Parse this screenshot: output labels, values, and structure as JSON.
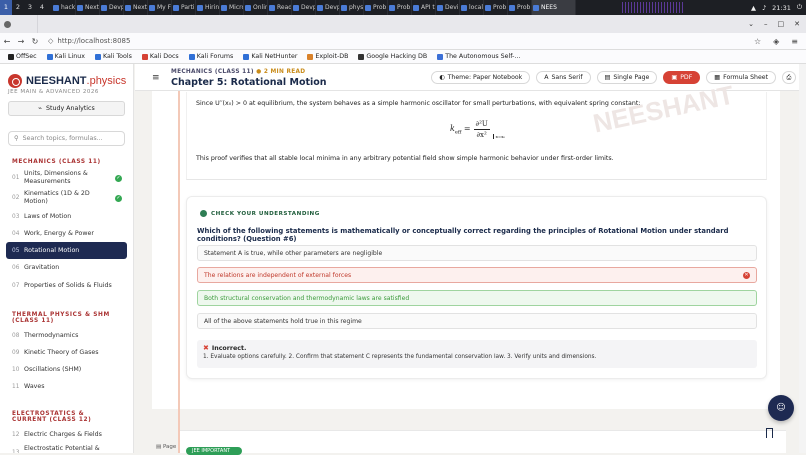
{
  "os_bar": {
    "workspaces": [
      "1",
      "2",
      "3",
      "4"
    ],
    "active_workspace": "1",
    "tabs": [
      "hack",
      "Next",
      "Devp",
      "Next",
      "My F",
      "Parti",
      "Hirin",
      "Micro",
      "Onlin",
      "Read",
      "Devp",
      "Devp",
      "phys",
      "Prob",
      "Prob",
      "API t",
      "Devi",
      "local",
      "Prob",
      "Prob",
      "NEES"
    ],
    "clock": "21:31"
  },
  "browser": {
    "url": "http://localhost:8085",
    "bookmarks": [
      "OffSec",
      "Kali Linux",
      "Kali Tools",
      "Kali Docs",
      "Kali Forums",
      "Kali NetHunter",
      "Exploit-DB",
      "Google Hacking DB",
      "The Autonomous Self-..."
    ]
  },
  "sidebar": {
    "brand_main": "NEESHANT",
    "brand_accent": ".physics",
    "brand_sub": "JEE MAIN & ADVANCED 2026",
    "analytics_label": "Study Analytics",
    "search_placeholder": "Search topics, formulas...",
    "sections": [
      {
        "title": "MECHANICS (CLASS 11)",
        "items": [
          {
            "num": "01",
            "label": "Units, Dimensions & Measurements",
            "done": true
          },
          {
            "num": "02",
            "label": "Kinematics (1D & 2D Motion)",
            "done": true
          },
          {
            "num": "03",
            "label": "Laws of Motion"
          },
          {
            "num": "04",
            "label": "Work, Energy & Power"
          },
          {
            "num": "05",
            "label": "Rotational Motion",
            "active": true
          },
          {
            "num": "06",
            "label": "Gravitation"
          },
          {
            "num": "07",
            "label": "Properties of Solids & Fluids"
          }
        ]
      },
      {
        "title": "THERMAL PHYSICS & SHM (CLASS 11)",
        "items": [
          {
            "num": "08",
            "label": "Thermodynamics"
          },
          {
            "num": "09",
            "label": "Kinetic Theory of Gases"
          },
          {
            "num": "10",
            "label": "Oscillations (SHM)"
          },
          {
            "num": "11",
            "label": "Waves"
          }
        ]
      },
      {
        "title": "ELECTROSTATICS & CURRENT (CLASS 12)",
        "items": [
          {
            "num": "12",
            "label": "Electric Charges & Fields"
          },
          {
            "num": "13",
            "label": "Electrostatic Potential & Capacitance"
          }
        ]
      }
    ]
  },
  "topbar": {
    "breadcrumb": "MECHANICS (CLASS 11)",
    "read_time": "2 MIN READ",
    "chapter_title": "Chapter 5: Rotational Motion",
    "theme_label": "Theme: Paper Notebook",
    "font_label": "Sans Serif",
    "view_label": "Single Page",
    "pdf_label": "PDF",
    "formula_label": "Formula Sheet"
  },
  "proof": {
    "watermark": "NEESHANT",
    "para1": "Since U′′(x₀) > 0 at equilibrium, the system behaves as a simple harmonic oscillator for small perturbations, with equivalent spring constant:",
    "formula_lhs": "k",
    "formula_sub": "eff",
    "formula_num": "∂²U",
    "formula_den": "∂x²",
    "formula_eval": "x=x₀",
    "para2": "This proof verifies that all stable local minima in any arbitrary potential field show simple harmonic behavior under first-order limits."
  },
  "quiz": {
    "header": "CHECK YOUR UNDERSTANDING",
    "question": "Which of the following statements is mathematically or conceptually correct regarding the principles of Rotational Motion under standard conditions? (Question #6)",
    "options": [
      {
        "text": "Statement A is true, while other parameters are negligible",
        "state": "neutral"
      },
      {
        "text": "The relations are independent of external forces",
        "state": "wrong"
      },
      {
        "text": "Both structural conservation and thermodynamic laws are satisfied",
        "state": "correct"
      },
      {
        "text": "All of the above statements hold true in this regime",
        "state": "neutral"
      }
    ],
    "feedback_title": "Incorrect.",
    "feedback_text": "1. Evaluate options carefully. 2. Confirm that statement C represents the fundamental conservation law. 3. Verify units and dimensions."
  },
  "footer": {
    "page_label": "Page",
    "badge": "JEE IMPORTANT"
  },
  "colors": {
    "accent_red": "#d64235",
    "navy": "#1e2a52",
    "green": "#2e7d54"
  }
}
